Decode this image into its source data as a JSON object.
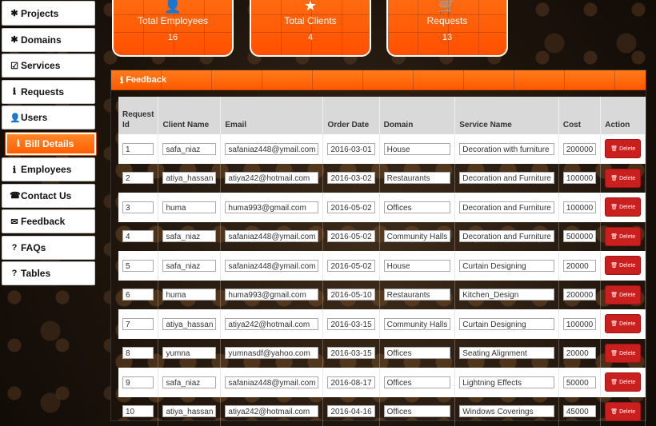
{
  "sidebar": {
    "items": [
      {
        "label": "Projects",
        "icon": "✱"
      },
      {
        "label": "Domains",
        "icon": "✱"
      },
      {
        "label": "Services",
        "icon": "☑"
      },
      {
        "label": "Requests",
        "icon": "ℹ"
      },
      {
        "label": "Users",
        "icon": "👤"
      },
      {
        "label": "Bill Details",
        "icon": "ℹ"
      },
      {
        "label": "Employees",
        "icon": "ℹ"
      },
      {
        "label": "Contact Us",
        "icon": "☎"
      },
      {
        "label": "Feedback",
        "icon": "✉"
      },
      {
        "label": "FAQs",
        "icon": "?"
      },
      {
        "label": "Tables",
        "icon": "?"
      }
    ]
  },
  "stats": [
    {
      "label": "Total Employees",
      "value": "16",
      "icon": "👤"
    },
    {
      "label": "Total Clients",
      "value": "4",
      "icon": "★"
    },
    {
      "label": "Requests",
      "value": "13",
      "icon": "🛒"
    }
  ],
  "panel": {
    "title": "Feedback",
    "icon": "ℹ"
  },
  "table": {
    "headers": [
      "Request Id",
      "Client Name",
      "Email",
      "Order Date",
      "Domain",
      "Service Name",
      "Cost",
      "Action"
    ],
    "action_label": "Delete",
    "rows": [
      [
        "1",
        "safa_niaz",
        "safaniaz448@ymail.com",
        "2016-03-01",
        "House",
        "Decoration with furniture",
        "200000"
      ],
      [
        "2",
        "atiya_hassan",
        "atiya242@hotmail.com",
        "2016-03-02",
        "Restaurants",
        "Decoration and Furniture",
        "100000"
      ],
      [
        "3",
        "huma",
        "huma993@gmail.com",
        "2016-05-02",
        "Offices",
        "Decoration and Furniture",
        "100000"
      ],
      [
        "4",
        "safa_niaz",
        "safaniaz448@ymail.com",
        "2016-05-02",
        "Community Halls",
        "Decoration and Furniture",
        "500000"
      ],
      [
        "5",
        "safa_niaz",
        "safaniaz448@ymail.com",
        "2016-05-02",
        "House",
        "Curtain Designing",
        "20000"
      ],
      [
        "6",
        "huma",
        "huma993@gmail.com",
        "2016-05-10",
        "Restaurants",
        "Kitchen_Design",
        "200000"
      ],
      [
        "7",
        "atiya_hassan",
        "atiya242@hotmail.com",
        "2016-03-15",
        "Community Halls",
        "Curtain Designing",
        "100000"
      ],
      [
        "8",
        "yumna",
        "yumnasdf@yahoo.com",
        "2016-03-15",
        "Offices",
        "Seating Alignment",
        "20000"
      ],
      [
        "9",
        "safa_niaz",
        "safaniaz448@ymail.com",
        "2016-08-17",
        "Offices",
        "Lightning Effects",
        "50000"
      ],
      [
        "10",
        "atiya_hassan",
        "atiya242@hotmail.com",
        "2016-04-16",
        "Offices",
        "Windows Coverings",
        "45000"
      ]
    ]
  }
}
